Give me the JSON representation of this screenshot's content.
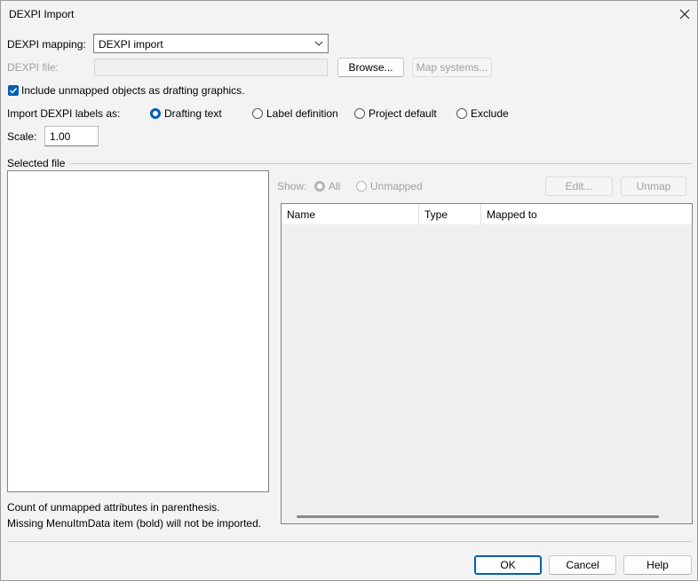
{
  "window": {
    "title": "DEXPI Import"
  },
  "mapping": {
    "label": "DEXPI mapping:",
    "value": "DEXPI import"
  },
  "file": {
    "label": "DEXPI file:",
    "value": "",
    "browse_label": "Browse...",
    "map_systems_label": "Map systems..."
  },
  "include_unmapped": {
    "label": "Include unmapped objects as drafting graphics.",
    "checked": true
  },
  "labels_as": {
    "label": "Import DEXPI labels as:",
    "options": [
      "Drafting text",
      "Label definition",
      "Project default",
      "Exclude"
    ],
    "selected": "Drafting text"
  },
  "scale": {
    "label": "Scale:",
    "value": "1.00"
  },
  "selected_file": {
    "label": "Selected file"
  },
  "show": {
    "label": "Show:",
    "all_label": "All",
    "unmapped_label": "Unmapped",
    "selected": "All"
  },
  "actions": {
    "edit_label": "Edit...",
    "unmap_label": "Unmap"
  },
  "table": {
    "columns": [
      "Name",
      "Type",
      "Mapped to"
    ],
    "rows": []
  },
  "notes": {
    "line1": "Count of unmapped attributes in parenthesis.",
    "line2": "Missing MenuItmData item (bold) will not be imported."
  },
  "footer": {
    "ok_label": "OK",
    "cancel_label": "Cancel",
    "help_label": "Help"
  },
  "colors": {
    "accent": "#005fb8",
    "window_bg": "#f3f3f3"
  }
}
